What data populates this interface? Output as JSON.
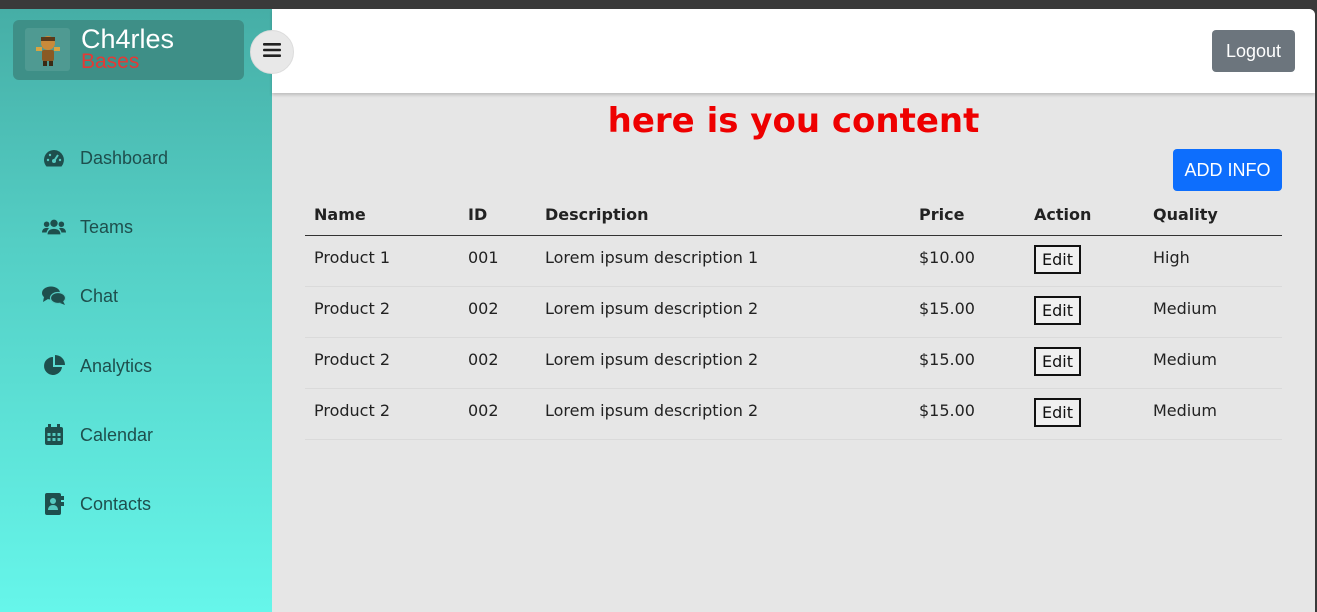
{
  "brand": {
    "name": "Ch4rles",
    "sub": "Bases",
    "sub_color": "#e53935"
  },
  "nav": [
    {
      "label": "Dashboard",
      "icon": "gauge-icon"
    },
    {
      "label": "Teams",
      "icon": "users-icon"
    },
    {
      "label": "Chat",
      "icon": "chat-icon"
    },
    {
      "label": "Analytics",
      "icon": "pie-chart-icon"
    },
    {
      "label": "Calendar",
      "icon": "calendar-icon"
    },
    {
      "label": "Contacts",
      "icon": "contact-book-icon"
    }
  ],
  "topbar": {
    "logout_label": "Logout",
    "menu_icon": "hamburger-icon"
  },
  "content": {
    "title": "here is you content",
    "title_color": "#ee0000",
    "add_label": "ADD INFO",
    "add_color": "#0d6efd"
  },
  "table": {
    "headers": {
      "name": "Name",
      "id": "ID",
      "description": "Description",
      "price": "Price",
      "action": "Action",
      "quality": "Quality"
    },
    "rows": [
      {
        "name": "Product 1",
        "id": "001",
        "description": "Lorem ipsum description 1",
        "price": "$10.00",
        "action": "Edit",
        "quality": "High"
      },
      {
        "name": "Product 2",
        "id": "002",
        "description": "Lorem ipsum description 2",
        "price": "$15.00",
        "action": "Edit",
        "quality": "Medium"
      },
      {
        "name": "Product 2",
        "id": "002",
        "description": "Lorem ipsum description 2",
        "price": "$15.00",
        "action": "Edit",
        "quality": "Medium"
      },
      {
        "name": "Product 2",
        "id": "002",
        "description": "Lorem ipsum description 2",
        "price": "$15.00",
        "action": "Edit",
        "quality": "Medium"
      }
    ]
  }
}
